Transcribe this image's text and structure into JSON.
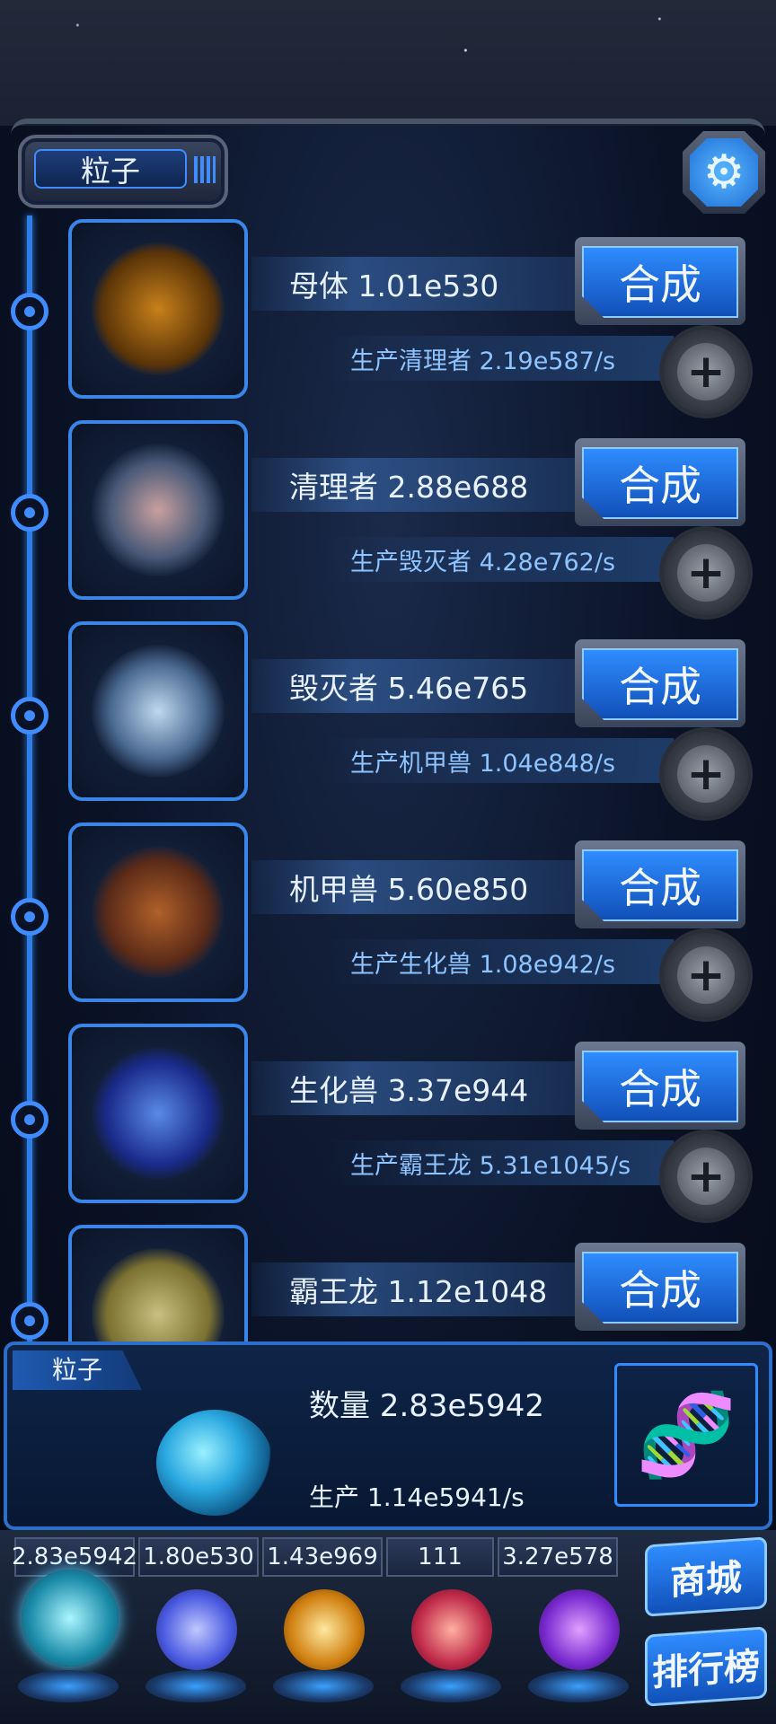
{
  "header": {
    "title": "粒子"
  },
  "units": [
    {
      "name": "母体 1.01e530",
      "merge_label": "合成",
      "production": "生产清理者 2.19e587/s",
      "art": "mother-creature-icon"
    },
    {
      "name": "清理者 2.88e688",
      "merge_label": "合成",
      "production": "生产毁灭者 4.28e762/s",
      "art": "cleaner-robot-icon"
    },
    {
      "name": "毁灭者 5.46e765",
      "merge_label": "合成",
      "production": "生产机甲兽 1.04e848/s",
      "art": "destroyer-mech-icon"
    },
    {
      "name": "机甲兽 5.60e850",
      "merge_label": "合成",
      "production": "生产生化兽 1.08e942/s",
      "art": "mecha-beast-icon"
    },
    {
      "name": "生化兽 3.37e944",
      "merge_label": "合成",
      "production": "生产霸王龙 5.31e1045/s",
      "art": "bio-dragon-icon"
    },
    {
      "name": "霸王龙 1.12e1048",
      "merge_label": "合成",
      "art": "trex-icon"
    }
  ],
  "bottom_panel": {
    "label": "粒子",
    "count": "数量 2.83e5942",
    "production": "生产 1.14e5941/s"
  },
  "tabs": [
    {
      "value": "2.83e5942",
      "color": "#3ad0e0"
    },
    {
      "value": "1.80e530",
      "color": "#6a7ae8"
    },
    {
      "value": "1.43e969",
      "color": "#e0a020"
    },
    {
      "value": "111",
      "color": "#e04a6a"
    },
    {
      "value": "3.27e578",
      "color": "#8a3ae0"
    }
  ],
  "side_buttons": {
    "shop": "商城",
    "ranking": "排行榜"
  },
  "colors": {
    "accent": "#2f8cff",
    "panel": "#0e2448"
  }
}
